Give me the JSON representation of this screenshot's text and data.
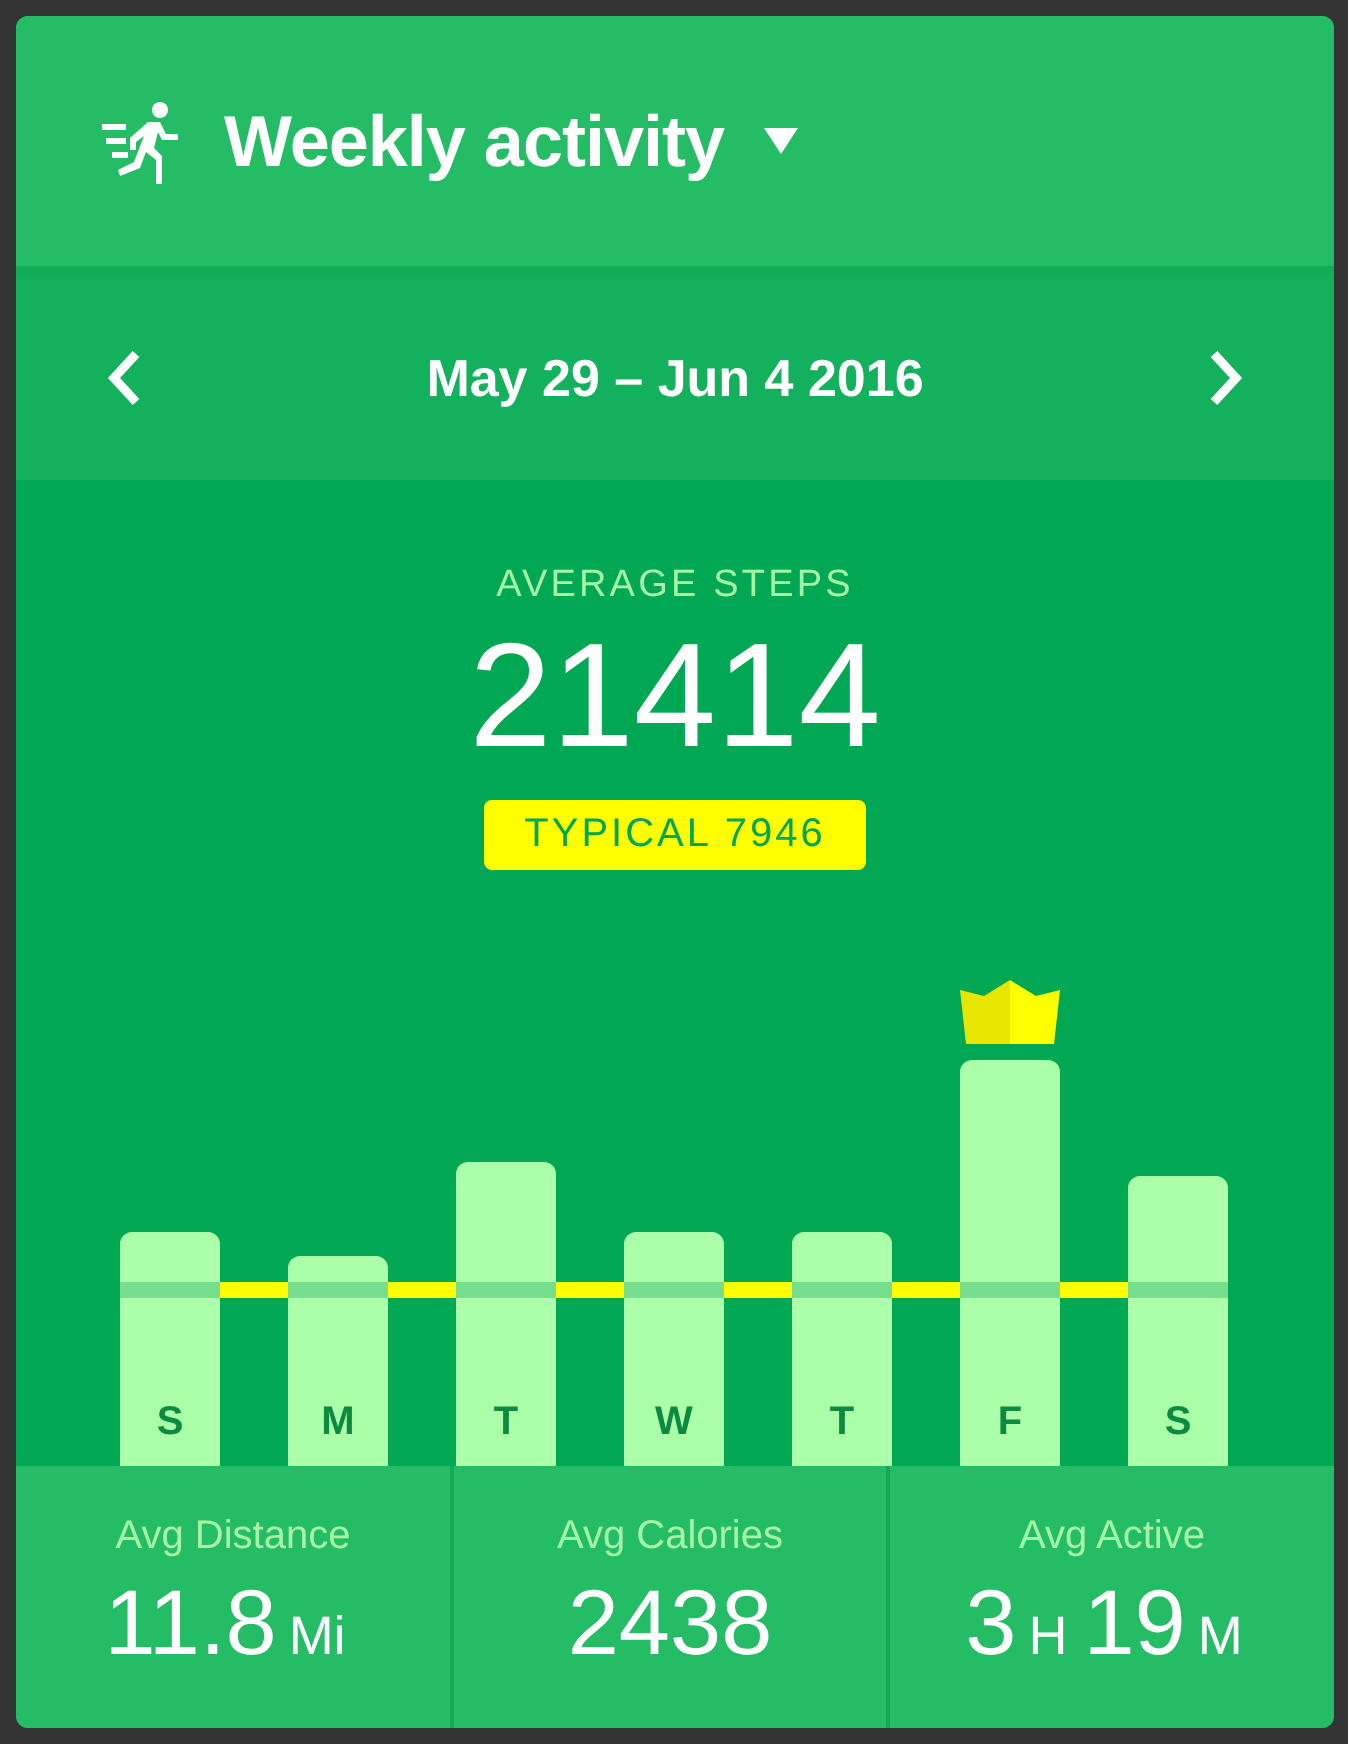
{
  "header": {
    "title": "Weekly activity"
  },
  "date_nav": {
    "range": "May 29 – Jun 4 2016"
  },
  "summary": {
    "label": "AVERAGE STEPS",
    "value": "21414",
    "typical": "TYPICAL 7946"
  },
  "week": {
    "days": [
      {
        "label": "S"
      },
      {
        "label": "M"
      },
      {
        "label": "T"
      },
      {
        "label": "W"
      },
      {
        "label": "T"
      },
      {
        "label": "F"
      },
      {
        "label": "S"
      }
    ]
  },
  "stats": [
    {
      "label": "Avg Distance",
      "parts": [
        {
          "kind": "number",
          "text": "11.8"
        },
        {
          "kind": "unit",
          "text": "Mi"
        }
      ]
    },
    {
      "label": "Avg Calories",
      "parts": [
        {
          "kind": "number",
          "text": "2438"
        }
      ]
    },
    {
      "label": "Avg Active",
      "parts": [
        {
          "kind": "number",
          "text": "3"
        },
        {
          "kind": "unit",
          "text": "H"
        },
        {
          "kind": "number",
          "text": "19"
        },
        {
          "kind": "unit",
          "text": "M"
        }
      ]
    }
  ]
}
